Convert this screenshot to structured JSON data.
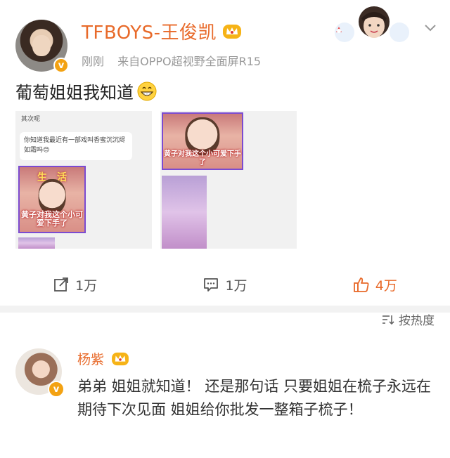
{
  "post": {
    "username": "TFBOYS-王俊凯",
    "time": "刚刚",
    "source": "来自OPPO超视野全面屏R15",
    "text": "葡萄姐姐我知道",
    "image1": {
      "label": "其次呢",
      "chat": "你知道我最近有一部戏叫香蜜沉沉烬如霜吗😊",
      "caption_top": "生　活",
      "caption": "黄子对我这个小可爱下手了"
    },
    "image2": {
      "caption": "黄子对我这个小可爱下手了"
    },
    "actions": {
      "repost": "1万",
      "comment": "1万",
      "like": "4万"
    }
  },
  "sort": {
    "label": "按热度"
  },
  "comment": {
    "username": "杨紫",
    "text": "弟弟 姐姐就知道！ 还是那句话 只要姐姐在梳子永远在 期待下次见面 姐姐给你批发一整箱子梳子！"
  },
  "colors": {
    "accent": "#e86a2a",
    "verified": "#f3a213",
    "meta": "#999999"
  },
  "icons": [
    "verified-badge-icon",
    "crown-icon",
    "chevron-down-icon",
    "grin-emoji-icon",
    "repost-icon",
    "comment-icon",
    "like-icon",
    "sort-icon"
  ]
}
